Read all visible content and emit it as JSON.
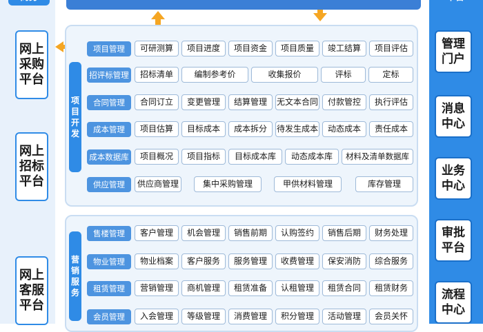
{
  "left": {
    "header": "商务",
    "boxes": [
      "网上\n采购\n平台",
      "网上\n招标\n平台",
      "网上\n客服\n平台"
    ]
  },
  "right": {
    "header": "平台",
    "boxes": [
      "管理\n门户",
      "消息\n中心",
      "业务\n中心",
      "审批\n平台",
      "流程\n中心"
    ]
  },
  "project_dev": {
    "side_label": "项\n目\n开\n发",
    "rows": [
      {
        "label": "项目管理",
        "cells": [
          "可研测算",
          "项目进度",
          "项目资金",
          "项目质量",
          "竣工结算",
          "项目评估"
        ]
      },
      {
        "label": "招评标管理",
        "cells": [
          "招标清单",
          "编制参考价",
          "收集报价",
          "评标",
          "定标"
        ]
      },
      {
        "label": "合同管理",
        "cells": [
          "合同订立",
          "变更管理",
          "结算管理",
          "无文本合同",
          "付款管控",
          "执行评估"
        ]
      },
      {
        "label": "成本管理",
        "cells": [
          "项目估算",
          "目标成本",
          "成本拆分",
          "待发生成本",
          "动态成本",
          "责任成本"
        ]
      },
      {
        "label": "成本数据库",
        "cells": [
          "项目概况",
          "项目指标",
          "目标成本库",
          "动态成本库",
          "材料及清单数据库"
        ]
      },
      {
        "label": "供应管理",
        "cells": [
          "供应商管理",
          "集中采购管理",
          "甲供材料管理",
          "库存管理"
        ]
      }
    ]
  },
  "marketing": {
    "side_label": "营\n销\n服\n务",
    "rows": [
      {
        "label": "售楼管理",
        "cells": [
          "客户管理",
          "机会管理",
          "销售前期",
          "认购签约",
          "销售后期",
          "财务处理"
        ]
      },
      {
        "label": "物业管理",
        "cells": [
          "物业档案",
          "客户服务",
          "服务管理",
          "收费管理",
          "保安消防",
          "综合服务"
        ]
      },
      {
        "label": "租赁管理",
        "cells": [
          "营销管理",
          "商机管理",
          "租赁准备",
          "认租管理",
          "租赁合同",
          "租赁财务"
        ]
      },
      {
        "label": "会员管理",
        "cells": [
          "入会管理",
          "等级管理",
          "消费管理",
          "积分管理",
          "活动管理",
          "会员关怀"
        ]
      }
    ]
  },
  "colors": {
    "primary": "#2f8be6",
    "arrow": "#f5a623",
    "panel_bg": "#eef5fc"
  }
}
